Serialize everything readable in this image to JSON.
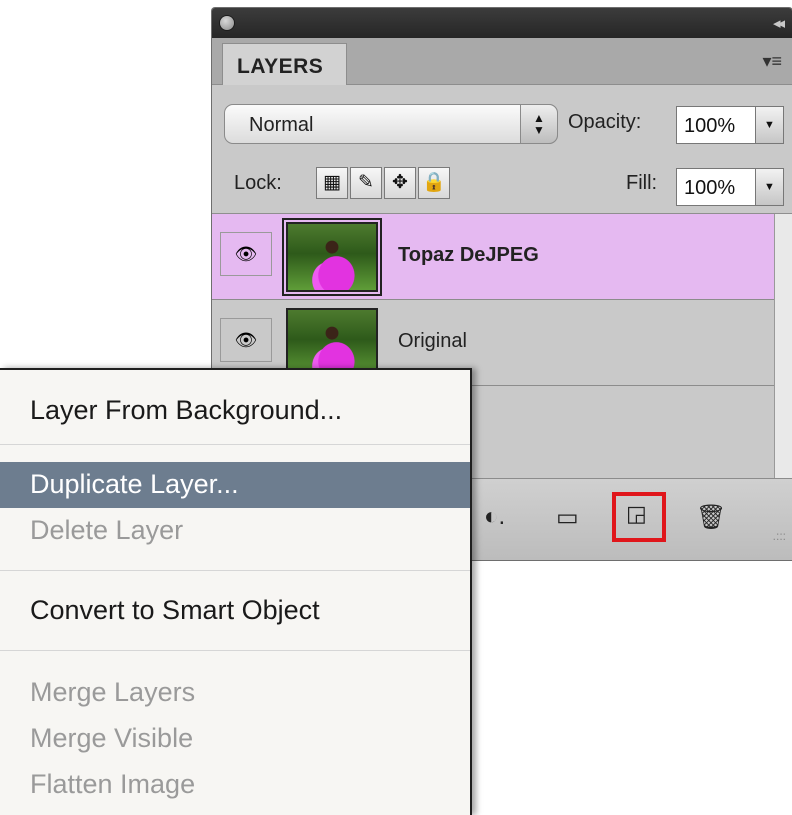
{
  "panel": {
    "tab_label": "LAYERS",
    "blend_mode": "Normal",
    "opacity_label": "Opacity:",
    "opacity_value": "100%",
    "lock_label": "Lock:",
    "fill_label": "Fill:",
    "fill_value": "100%",
    "layers": [
      {
        "name": "Topaz DeJPEG",
        "selected": true
      },
      {
        "name": "Original",
        "selected": false
      }
    ],
    "highlight_color": "#e0161b",
    "selected_row_color": "#e5b9f1"
  },
  "menu": {
    "items": [
      {
        "label": "Layer From Background...",
        "enabled": true
      },
      {
        "label": "Duplicate Layer...",
        "enabled": true,
        "highlighted": true
      },
      {
        "label": "Delete Layer",
        "enabled": false
      },
      {
        "label": "Convert to Smart Object",
        "enabled": true
      },
      {
        "label": "Merge Layers",
        "enabled": false
      },
      {
        "label": "Merge Visible",
        "enabled": false
      },
      {
        "label": "Flatten Image",
        "enabled": false
      }
    ],
    "highlight_color": "#6d7d8f"
  }
}
